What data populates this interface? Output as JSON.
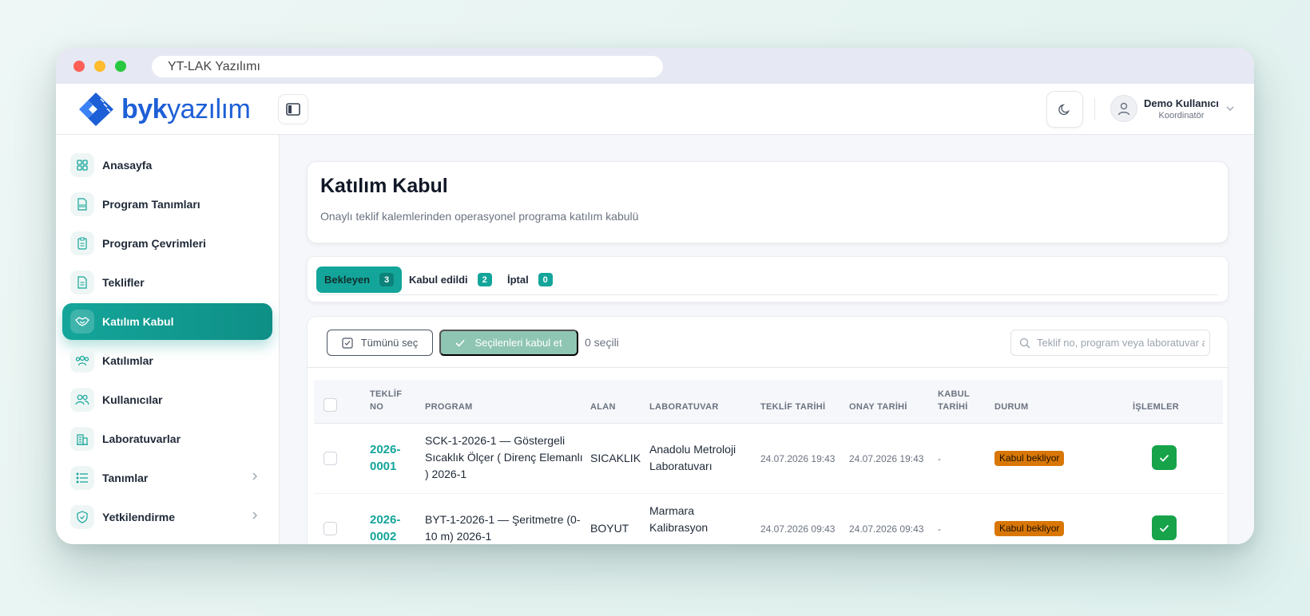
{
  "window": {
    "url_text": "YT-LAK Yazılımı"
  },
  "brand": {
    "logo_bold": "byk",
    "logo_light": "yazılım",
    "accent": "#14a59a",
    "logo_color": "#1d5fd6"
  },
  "user": {
    "name": "Demo Kullanıcı",
    "role": "Koordinatör"
  },
  "sidebar": {
    "items": [
      {
        "label": "Anasayfa",
        "icon": "grid-icon"
      },
      {
        "label": "Program Tanımları",
        "icon": "doc-file-icon"
      },
      {
        "label": "Program Çevrimleri",
        "icon": "clipboard-icon"
      },
      {
        "label": "Teklifler",
        "icon": "file-text-icon"
      },
      {
        "label": "Katılım Kabul",
        "icon": "handshake-icon",
        "active": true
      },
      {
        "label": "Katılımlar",
        "icon": "users-group-icon"
      },
      {
        "label": "Kullanıcılar",
        "icon": "users-icon"
      },
      {
        "label": "Laboratuvarlar",
        "icon": "building-icon"
      },
      {
        "label": "Tanımlar",
        "icon": "list-icon",
        "has_children": true
      },
      {
        "label": "Yetkilendirme",
        "icon": "shield-check-icon",
        "has_children": true
      }
    ]
  },
  "page": {
    "title": "Katılım Kabul",
    "subtitle": "Onaylı teklif kalemlerinden operasyonel programa katılım kabulü"
  },
  "tabs": [
    {
      "label": "Bekleyen",
      "count": "3",
      "active": true
    },
    {
      "label": "Kabul edildi",
      "count": "2"
    },
    {
      "label": "İptal",
      "count": "0"
    }
  ],
  "toolbar": {
    "select_all": "Tümünü seç",
    "accept_selected": "Seçilenleri kabul et",
    "selected_count": "0 seçili",
    "search_placeholder": "Teklif no, program veya laboratuvar a"
  },
  "table": {
    "headers": {
      "teklif_no_1": "TEKLİF",
      "teklif_no_2": "NO",
      "program": "PROGRAM",
      "alan": "ALAN",
      "laboratuvar": "LABORATUVAR",
      "teklif_tarihi": "TEKLİF TARİHİ",
      "onay_tarihi": "ONAY TARİHİ",
      "kabul_tarihi_1": "KABUL",
      "kabul_tarihi_2": "TARİHİ",
      "durum": "DURUM",
      "islemler": "İŞLEMLER"
    },
    "rows": [
      {
        "teklif_no_1": "2026-",
        "teklif_no_2": "0001",
        "program_1": "SCK-1-2026-1 — Göstergeli",
        "program_2": "Sıcaklık Ölçer ( Direnç Elemanlı",
        "program_3": ") 2026-1",
        "alan": "SICAKLIK",
        "lab_1": "Anadolu Metroloji",
        "lab_2": "Laboratuvarı",
        "lab_3": "",
        "teklif_tarihi": "24.07.2026 19:43",
        "onay_tarihi": "24.07.2026 19:43",
        "kabul_tarihi": "-",
        "durum": "Kabul bekliyor"
      },
      {
        "teklif_no_1": "2026-",
        "teklif_no_2": "0002",
        "program_1": "BYT-1-2026-1 — Şeritmetre (0-",
        "program_2": "10 m) 2026-1",
        "program_3": "",
        "alan": "BOYUT",
        "lab_1": "Marmara",
        "lab_2": "Kalibrasyon",
        "lab_3": "",
        "teklif_tarihi": "24.07.2026 09:43",
        "onay_tarihi": "24.07.2026 09:43",
        "kabul_tarihi": "-",
        "durum": "Kabul bekliyor"
      }
    ]
  }
}
